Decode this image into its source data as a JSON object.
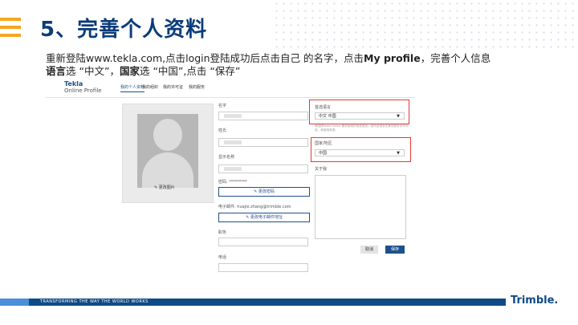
{
  "slide": {
    "title": "5、完善个人资料",
    "line1_a": "重新登陆www.tekla.com,点击login登陆成功后点击自己 的名字，点击",
    "line1_b": "My profile",
    "line1_c": "，完善个人信息",
    "line2_a": "语言",
    "line2_b": "选 “中文”，",
    "line2_c": "国家",
    "line2_d": "选 “中国”,点击 “保存”",
    "footer_text": "TRANSFORMING THE WAY THE WORLD WORKS",
    "brand": "Trimble."
  },
  "app": {
    "logo_line1": "Tekla",
    "logo_line2": "Online Profile",
    "nav": [
      "我的个人资料",
      "我的组织",
      "我的许可证",
      "我的服务"
    ],
    "change_photo": "更改图片"
  },
  "form": {
    "first_name_label": "名字",
    "last_name_label": "姓氏",
    "display_name_label": "显示名称",
    "password_label": "密码: *********",
    "change_password": "更改密码",
    "email_label": "电子邮件: huajie.zhang@trimble.com",
    "change_email": "更改电子邮件地址",
    "job_label": "职务",
    "phone_label": "电话",
    "language_label": "首选语言",
    "language_value": "中文 中国",
    "language_note": "请选择Tekla Online 服务使用的首选语言。若所选语言在某些服务中不可用，将使用英语。",
    "country_label": "国家/地区",
    "country_value": "中国",
    "about_label": "关于我",
    "cancel": "取消",
    "save": "保存"
  },
  "colors": {
    "title": "#0b3c7a",
    "accent_bars": "#f5a623",
    "highlight_box": "#e53935",
    "primary": "#1e4f8a",
    "footer": "#0e4a86"
  }
}
